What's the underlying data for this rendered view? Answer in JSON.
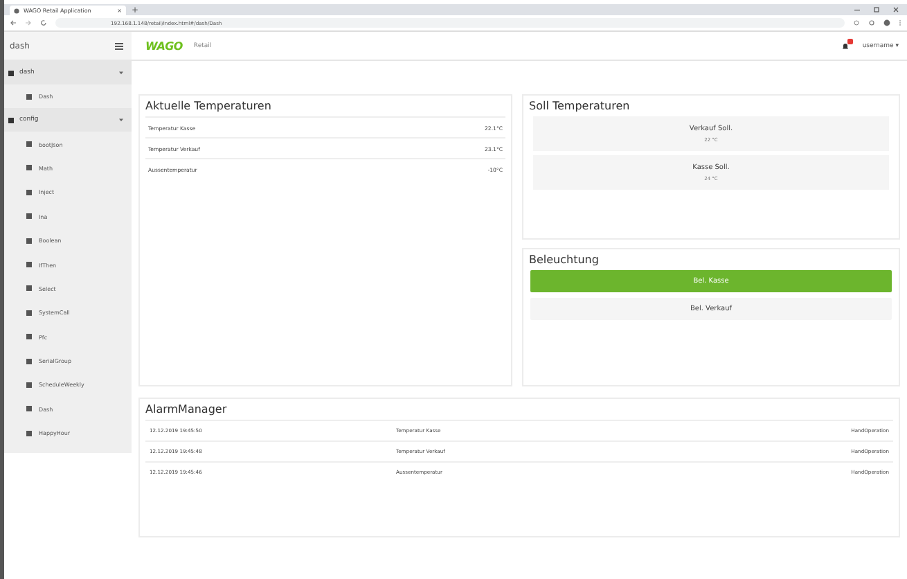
{
  "browser": {
    "tab_title": "WAGO Retail Application",
    "tab_close": "×",
    "new_tab": "+",
    "url": "192.168.1.148/retail/index.html#/dash/Dash"
  },
  "header": {
    "sidebar_title": "dash",
    "logo": "WAGO",
    "app_name": "Retail",
    "user": "username ▾"
  },
  "sidebar": {
    "groups": [
      {
        "label": "dash",
        "expanded": true,
        "children": [
          {
            "label": "Dash"
          }
        ]
      },
      {
        "label": "config",
        "expanded": true,
        "children": [
          {
            "label": "bootJson"
          },
          {
            "label": "Math"
          },
          {
            "label": "Inject"
          },
          {
            "label": "Ina"
          },
          {
            "label": "Boolean"
          },
          {
            "label": "IfThen"
          },
          {
            "label": "Select"
          },
          {
            "label": "SystemCall"
          },
          {
            "label": "Pfc"
          },
          {
            "label": "SerialGroup"
          },
          {
            "label": "ScheduleWeekly"
          },
          {
            "label": "Dash"
          },
          {
            "label": "HappyHour"
          }
        ]
      }
    ]
  },
  "actual": {
    "title": "Aktuelle Temperaturen",
    "rows": [
      {
        "name": "Temperatur Kasse",
        "value": "22.1°C"
      },
      {
        "name": "Temperatur Verkauf",
        "value": "23.1°C"
      },
      {
        "name": "Aussentemperatur",
        "value": "-10°C"
      }
    ]
  },
  "setpoints": {
    "title": "Soll Temperaturen",
    "items": [
      {
        "name": "Verkauf Soll.",
        "value": "22 °C"
      },
      {
        "name": "Kasse Soll.",
        "value": "24 °C"
      }
    ]
  },
  "lighting": {
    "title": "Beleuchtung",
    "buttons": [
      {
        "label": "Bel. Kasse",
        "on": true
      },
      {
        "label": "Bel. Verkauf",
        "on": false
      }
    ]
  },
  "alarms": {
    "title": "AlarmManager",
    "rows": [
      {
        "time": "12.12.2019 19:45:50",
        "text": "Temperatur Kasse",
        "type": "HandOperation"
      },
      {
        "time": "12.12.2019 19:45:48",
        "text": "Temperatur Verkauf",
        "type": "HandOperation"
      },
      {
        "time": "12.12.2019 19:45:46",
        "text": "Aussentemperatur",
        "type": "HandOperation"
      }
    ]
  }
}
